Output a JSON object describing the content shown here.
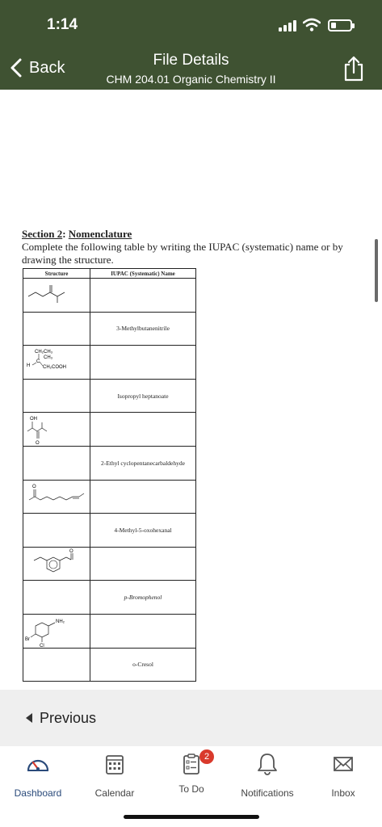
{
  "status": {
    "time": "1:14"
  },
  "header": {
    "back_label": "Back",
    "title": "File Details",
    "subtitle": "CHM 204.01 Organic Chemistry II",
    "bg_color": "#3f5232"
  },
  "document": {
    "section_prefix": "Section 2",
    "section_colon": ": ",
    "section_title": "Nomenclature",
    "instructions": "Complete the following table by writing the IUPAC (systematic) name or by drawing the structure.",
    "columns": [
      "Structure",
      "IUPAC (Systematic) Name"
    ],
    "rows": [
      {
        "structure": "amide-structure",
        "name": ""
      },
      {
        "structure": "",
        "name": "3-Methylbutanenitrile"
      },
      {
        "structure": "branched-acid-structure",
        "name": "",
        "labels": [
          "CH₂CH₃",
          "CH₃",
          "H",
          "C",
          "CH₂COOH"
        ]
      },
      {
        "structure": "",
        "name": "Isopropyl heptanoate"
      },
      {
        "structure": "hydroxy-ketone-structure",
        "name": "",
        "labels": [
          "OH",
          "O"
        ]
      },
      {
        "structure": "",
        "name": "2-Ethyl cyclopentanecarbaldehyde"
      },
      {
        "structure": "enone-chain-structure",
        "name": "",
        "labels": [
          "O"
        ]
      },
      {
        "structure": "",
        "name": "4-Methyl-5-oxohexanal"
      },
      {
        "structure": "aryl-ketone-structure",
        "name": "",
        "labels": [
          "O"
        ]
      },
      {
        "structure": "",
        "name": "p-Bromophenol"
      },
      {
        "structure": "substituted-aniline-structure",
        "name": "",
        "labels": [
          "NH₂",
          "Br",
          "Cl"
        ]
      },
      {
        "structure": "",
        "name": "o-Cresol"
      }
    ]
  },
  "navigation": {
    "previous_label": "Previous"
  },
  "tabbar": {
    "items": [
      {
        "label": "Dashboard",
        "icon": "dashboard-icon",
        "active": true
      },
      {
        "label": "Calendar",
        "icon": "calendar-icon"
      },
      {
        "label": "To Do",
        "icon": "todo-icon",
        "badge": "2"
      },
      {
        "label": "Notifications",
        "icon": "bell-icon"
      },
      {
        "label": "Inbox",
        "icon": "inbox-icon"
      }
    ],
    "badge_color": "#d93a2c"
  }
}
